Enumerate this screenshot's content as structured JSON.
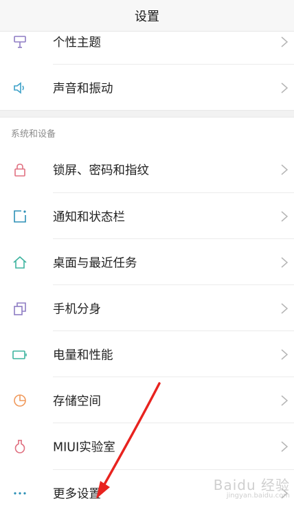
{
  "header": {
    "title": "设置"
  },
  "rows_top": [
    {
      "label": "个性主题",
      "icon": "theme-brush-icon"
    },
    {
      "label": "声音和振动",
      "icon": "speaker-icon"
    }
  ],
  "section": {
    "title": "系统和设备"
  },
  "rows_system": [
    {
      "label": "锁屏、密码和指纹",
      "icon": "lock-icon"
    },
    {
      "label": "通知和状态栏",
      "icon": "notification-icon"
    },
    {
      "label": "桌面与最近任务",
      "icon": "home-icon"
    },
    {
      "label": "手机分身",
      "icon": "dual-copy-icon"
    },
    {
      "label": "电量和性能",
      "icon": "battery-icon"
    },
    {
      "label": "存储空间",
      "icon": "storage-pie-icon"
    },
    {
      "label": "MIUI实验室",
      "icon": "flask-icon"
    },
    {
      "label": "更多设置",
      "icon": "more-dots-icon"
    }
  ],
  "watermark": {
    "logo": "Baidu 经验",
    "url": "jingyan.baidu.com"
  },
  "colors": {
    "theme": "#8e7cc3",
    "sound": "#3aa0c8",
    "lock": "#e07080",
    "notify": "#2b8fb5",
    "home": "#3cb39e",
    "dual": "#8e7cc3",
    "battery": "#3cb39e",
    "storage": "#f0985a",
    "lab": "#e07080",
    "more": "#2b8fb5",
    "arrow": "#e8231f"
  }
}
